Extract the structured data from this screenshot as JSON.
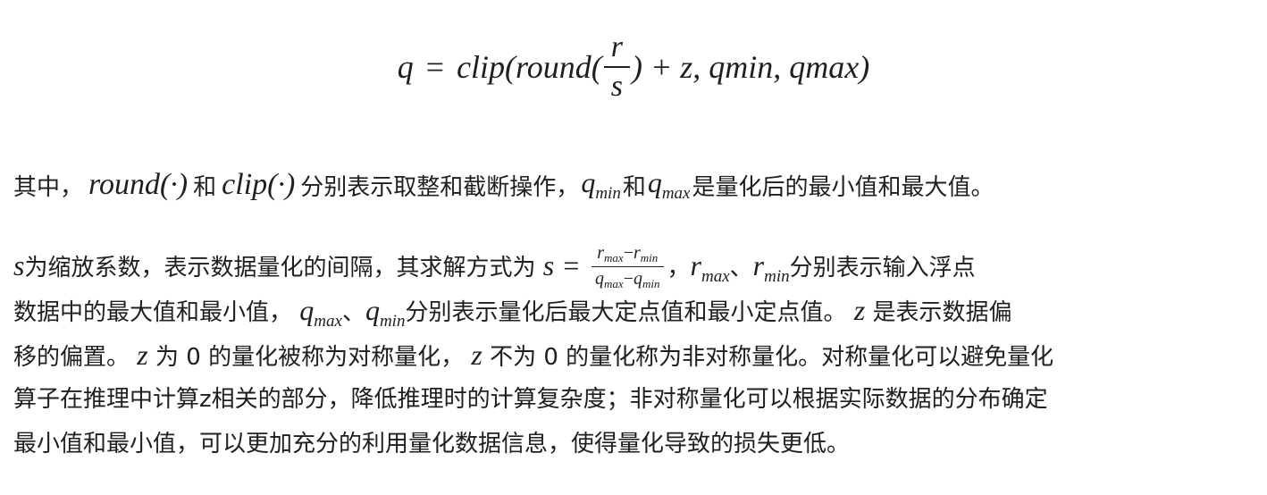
{
  "formula": {
    "q": "q",
    "eq": "=",
    "clip_open": "clip(round(",
    "frac_num": "r",
    "frac_den": "s",
    "close_part": ") + z, qmin, qmax)"
  },
  "paragraph1": {
    "lead": "其中，",
    "round_fn": "round(·)",
    "and1": "和",
    "clip_fn": "clip(·)",
    "middle": "分别表示取整和截断操作，",
    "q_base": "q",
    "q_min_sub": "min",
    "and2": "和",
    "q_max_sub": "max",
    "tail": "是量化后的最小值和最大值。"
  },
  "paragraph2": {
    "s_var": "s",
    "line1_text": "为缩放系数，表示数据量化的间隔，其求解方式为",
    "s_eq": "s =",
    "frac_num_r": "r",
    "frac_num_sub_max": "max",
    "frac_minus": "−",
    "frac_num_sub_min": "min",
    "frac_den_q": "q",
    "line1_after_frac": "，",
    "r_var": "r",
    "r_max_sub": "max",
    "sep": "、",
    "r_min_sub": "min",
    "line1_tail": "分别表示输入浮点",
    "line2_head": "数据中的最大值和最小值，",
    "q_var": "q",
    "q_max_sub": "max",
    "q_min_sub": "min",
    "line2_mid": "分别表示量化后最大定点值和最小定点值。",
    "z_var": "z",
    "line2_tail": "是表示数据偏",
    "line3_head": "移的偏置。",
    "line3_z0": "为 0 的量化被称为对称量化，",
    "line3_znot0": "不为 0 的量化称为非对称量化。对称量化可以避免量化",
    "line4": "算子在推理中计算z相关的部分，降低推理时的计算复杂度；非对称量化可以根据实际数据的分布确定",
    "line5": "最小值和最小值，可以更加充分的利用量化数据信息，使得量化导致的损失更低。"
  }
}
